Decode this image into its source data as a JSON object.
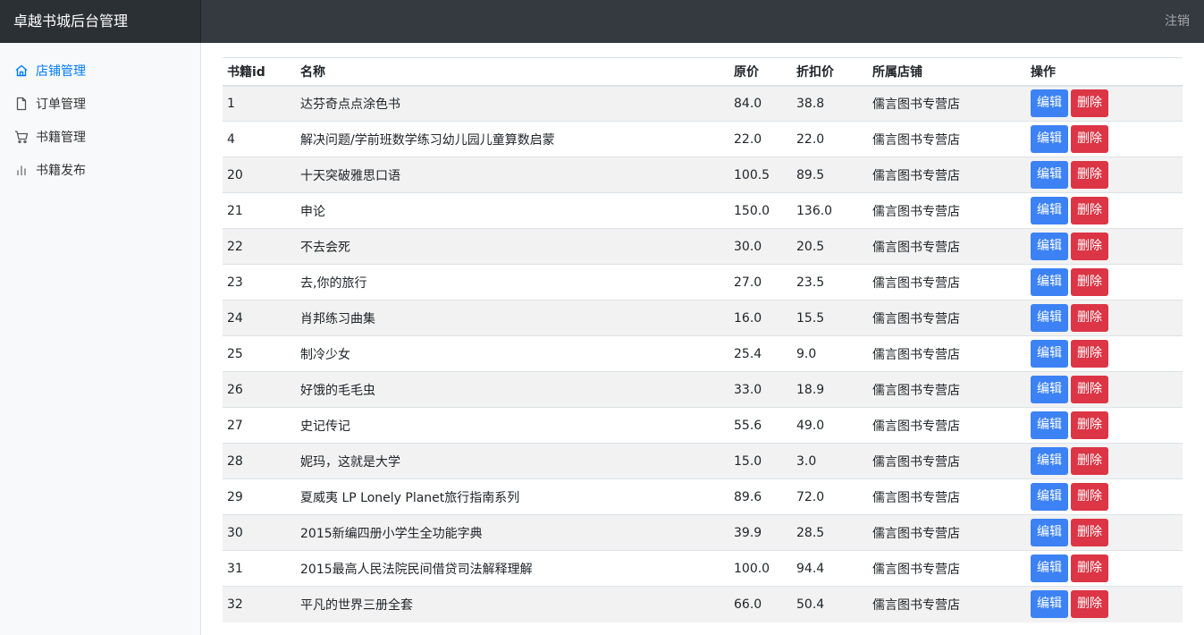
{
  "header": {
    "brand": "卓越书城后台管理",
    "logout_label": "注销"
  },
  "sidebar": {
    "items": [
      {
        "label": "店铺管理",
        "icon": "home-icon",
        "active": true
      },
      {
        "label": "订单管理",
        "icon": "file-icon",
        "active": false
      },
      {
        "label": "书籍管理",
        "icon": "cart-icon",
        "active": false
      },
      {
        "label": "书籍发布",
        "icon": "bar-chart-icon",
        "active": false
      }
    ]
  },
  "colors": {
    "navbar": "#343a40",
    "active_link": "#007bff",
    "edit_button": "#3c82f5",
    "delete_button": "#dc3545"
  },
  "table": {
    "columns": [
      "书籍id",
      "名称",
      "原价",
      "折扣价",
      "所属店铺",
      "操作"
    ],
    "edit_label": "编辑",
    "delete_label": "删除",
    "rows": [
      {
        "id": "1",
        "name": "达芬奇点点涂色书",
        "price": "84.0",
        "discount": "38.8",
        "shop": "儒言图书专营店"
      },
      {
        "id": "4",
        "name": "解决问题/学前班数学练习幼儿园儿童算数启蒙",
        "price": "22.0",
        "discount": "22.0",
        "shop": "儒言图书专营店"
      },
      {
        "id": "20",
        "name": "十天突破雅思口语",
        "price": "100.5",
        "discount": "89.5",
        "shop": "儒言图书专营店"
      },
      {
        "id": "21",
        "name": "申论",
        "price": "150.0",
        "discount": "136.0",
        "shop": "儒言图书专营店"
      },
      {
        "id": "22",
        "name": "不去会死",
        "price": "30.0",
        "discount": "20.5",
        "shop": "儒言图书专营店"
      },
      {
        "id": "23",
        "name": "去,你的旅行",
        "price": "27.0",
        "discount": "23.5",
        "shop": "儒言图书专营店"
      },
      {
        "id": "24",
        "name": "肖邦练习曲集",
        "price": "16.0",
        "discount": "15.5",
        "shop": "儒言图书专营店"
      },
      {
        "id": "25",
        "name": "制冷少女",
        "price": "25.4",
        "discount": "9.0",
        "shop": "儒言图书专营店"
      },
      {
        "id": "26",
        "name": "好饿的毛毛虫",
        "price": "33.0",
        "discount": "18.9",
        "shop": "儒言图书专营店"
      },
      {
        "id": "27",
        "name": "史记传记",
        "price": "55.6",
        "discount": "49.0",
        "shop": "儒言图书专营店"
      },
      {
        "id": "28",
        "name": "妮玛，这就是大学",
        "price": "15.0",
        "discount": "3.0",
        "shop": "儒言图书专营店"
      },
      {
        "id": "29",
        "name": "夏威夷 LP Lonely Planet旅行指南系列",
        "price": "89.6",
        "discount": "72.0",
        "shop": "儒言图书专营店"
      },
      {
        "id": "30",
        "name": "2015新编四册小学生全功能字典",
        "price": "39.9",
        "discount": "28.5",
        "shop": "儒言图书专营店"
      },
      {
        "id": "31",
        "name": "2015最高人民法院民间借贷司法解释理解",
        "price": "100.0",
        "discount": "94.4",
        "shop": "儒言图书专营店"
      },
      {
        "id": "32",
        "name": "平凡的世界三册全套",
        "price": "66.0",
        "discount": "50.4",
        "shop": "儒言图书专营店"
      }
    ]
  }
}
